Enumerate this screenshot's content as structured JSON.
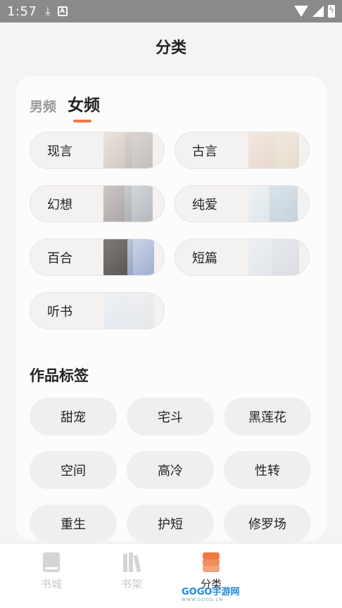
{
  "status_bar": {
    "time": "1:57",
    "download_icon": "download-icon",
    "notification_icon": "a-icon",
    "a_glyph": "A"
  },
  "page": {
    "title": "分类"
  },
  "gender_tabs": [
    {
      "label": "男频",
      "active": false
    },
    {
      "label": "女频",
      "active": true
    }
  ],
  "categories": [
    {
      "label": "现言"
    },
    {
      "label": "古言"
    },
    {
      "label": "幻想"
    },
    {
      "label": "纯爱"
    },
    {
      "label": "百合"
    },
    {
      "label": "短篇"
    },
    {
      "label": "听书"
    }
  ],
  "tags": {
    "title": "作品标签",
    "items": [
      "甜宠",
      "宅斗",
      "黑莲花",
      "空间",
      "高冷",
      "性转",
      "重生",
      "护短",
      "修罗场"
    ]
  },
  "bottom_nav": [
    {
      "label": "书城",
      "icon": "book-icon",
      "active": false
    },
    {
      "label": "书架",
      "icon": "bookshelf-icon",
      "active": false
    },
    {
      "label": "分类",
      "icon": "layers-icon",
      "active": true
    }
  ],
  "watermark": {
    "text": "GOGO手游网",
    "sub": "WWW.GOGO.CN"
  },
  "colors": {
    "accent": "#f07a44",
    "status_bar": "#8a8a8a"
  }
}
